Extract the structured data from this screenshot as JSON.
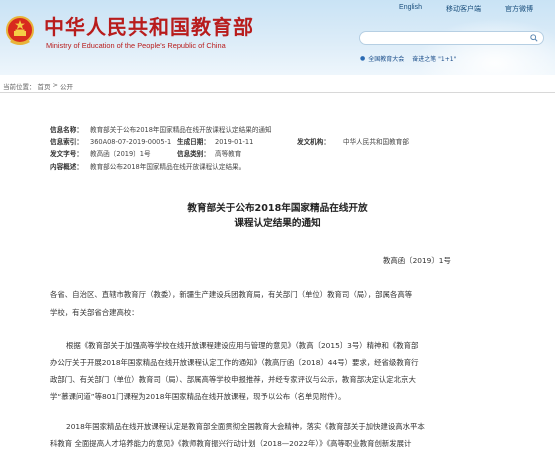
{
  "header": {
    "title_cn": "中华人民共和国教育部",
    "title_en": "Ministry of Education of the People's Republic of China",
    "links": [
      "English",
      "移动客户端",
      "官方微博"
    ],
    "search": {
      "placeholder": ""
    },
    "topics": [
      "全国教育大会",
      "奋进之笔 \"1+1\""
    ]
  },
  "breadcrumb": {
    "prefix": "当前位置：",
    "home": "首页",
    "sep": " > ",
    "current": "公开"
  },
  "info": {
    "title_label": "信息名称：",
    "title_value": "教育部关于公布2018年国家精品在线开放课程认定结果的通知",
    "index_label": "信息索引：",
    "index_value": "360A08-07-2019-0005-1",
    "date_label": "生成日期：",
    "date_value": "2019-01-11",
    "org_label": "发文机构：",
    "org_value": "中华人民共和国教育部",
    "doc_label": "发文字号：",
    "doc_value": "教高函〔2019〕1号",
    "cat_label": "信息类别：",
    "cat_value": "高等教育",
    "summary_label": "内容概述：",
    "summary_value": "教育部公布2018年国家精品在线开放课程认定结果。"
  },
  "article": {
    "title_line1": "教育部关于公布2018年国家精品在线开放",
    "title_line2": "课程认定结果的通知",
    "doc_number": "教高函〔2019〕1号",
    "p1": "各省、自治区、直辖市教育厅（教委），新疆生产建设兵团教育局，有关部门（单位）教育司（局），部属各高等",
    "p2": "学校，有关部省合建高校：",
    "p3": "根据《教育部关于加强高等学校在线开放课程建设应用与管理的意见》（教高〔2015〕3号）精神和《教育部",
    "p4": "办公厅关于开展2018年国家精品在线开放课程认定工作的通知》（教高厅函〔2018〕44号）要求，经省级教育行",
    "p5": "政部门、有关部门（单位）教育司（局）、部属高等学校申报推荐，并经专家评议与公示，教育部决定认定北京大",
    "p6": "学“慕课问道”等801门课程为2018年国家精品在线开放课程，现予以公布（名单见附件）。",
    "p7": "2018年国家精品在线开放课程认定是教育部全面贯彻全国教育大会精神，落实《教育部关于加快建设高水平本",
    "p8": "科教育 全面提高人才培养能力的意见》《教师教育振兴行动计划（2018—2022年）》《高等职业教育创新发展计"
  },
  "colors": {
    "brand_red": "#b81c1c",
    "header_blue": "#c9e3f5",
    "link_blue": "#1a4f7d"
  }
}
